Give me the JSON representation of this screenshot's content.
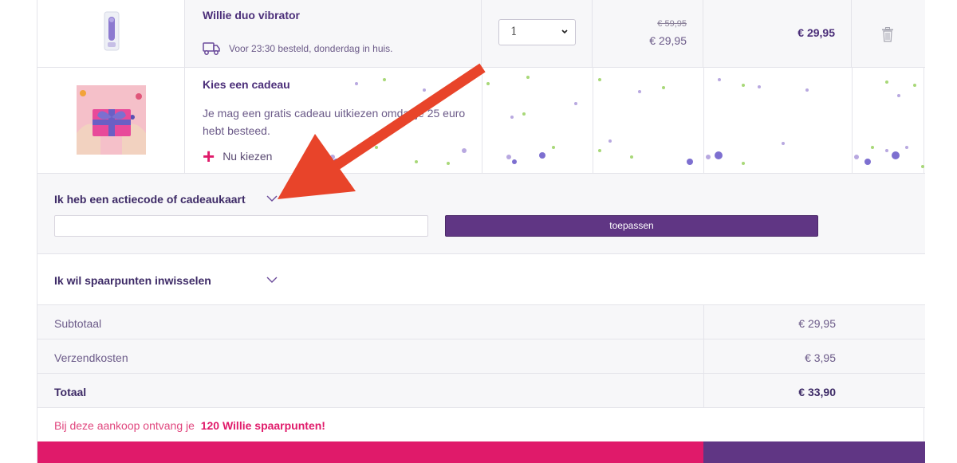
{
  "product": {
    "name": "Willie duo vibrator",
    "delivery_text": "Voor 23:30 besteld, donderdag in huis.",
    "quantity": "1",
    "old_price": "€ 59,95",
    "new_price": "€ 29,95",
    "line_total": "€ 29,95"
  },
  "gift": {
    "title": "Kies een cadeau",
    "description": "Je mag een gratis cadeau uitkiezen omdat je 25 euro hebt besteed.",
    "choose_label": "Nu kiezen"
  },
  "promo": {
    "title": "Ik heb een actiecode of cadeaukaart",
    "input_value": "",
    "apply_label": "toepassen"
  },
  "points_section": {
    "title": "Ik wil spaarpunten inwisselen"
  },
  "summary": {
    "subtotal_label": "Subtotaal",
    "subtotal_value": "€ 29,95",
    "shipping_label": "Verzendkosten",
    "shipping_value": "€ 3,95",
    "total_label": "Totaal",
    "total_value": "€ 33,90"
  },
  "earn": {
    "prefix": "Bij deze aankoop ontvang je",
    "points": "120 Willie spaarpunten!"
  },
  "colors": {
    "brand_purple": "#603684",
    "brand_pink": "#e01a6a",
    "arrow_red": "#e8442a"
  }
}
